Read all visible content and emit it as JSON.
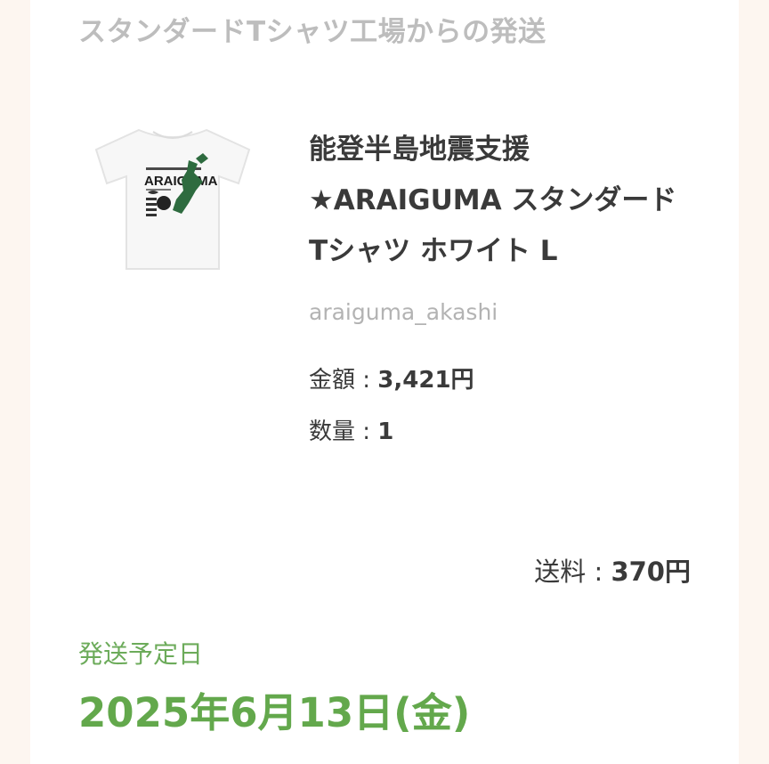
{
  "section_title": "スタンダードTシャツ工場からの発送",
  "product": {
    "name": "能登半島地震支援★ARAIGUMA スタンダードTシャツ ホワイト L",
    "shop": "araiguma_akashi",
    "image_print_text": "ARAIGUMA",
    "accent_color": "#2e6b3f"
  },
  "price": {
    "label": "金額 : ",
    "value": "3,421円"
  },
  "quantity": {
    "label": "数量 : ",
    "value": "1"
  },
  "shipping": {
    "label": "送料 : ",
    "value": "370円"
  },
  "ship_date": {
    "label": "発送予定日",
    "value": "2025年6月13日(金)",
    "color": "#63a84c"
  }
}
